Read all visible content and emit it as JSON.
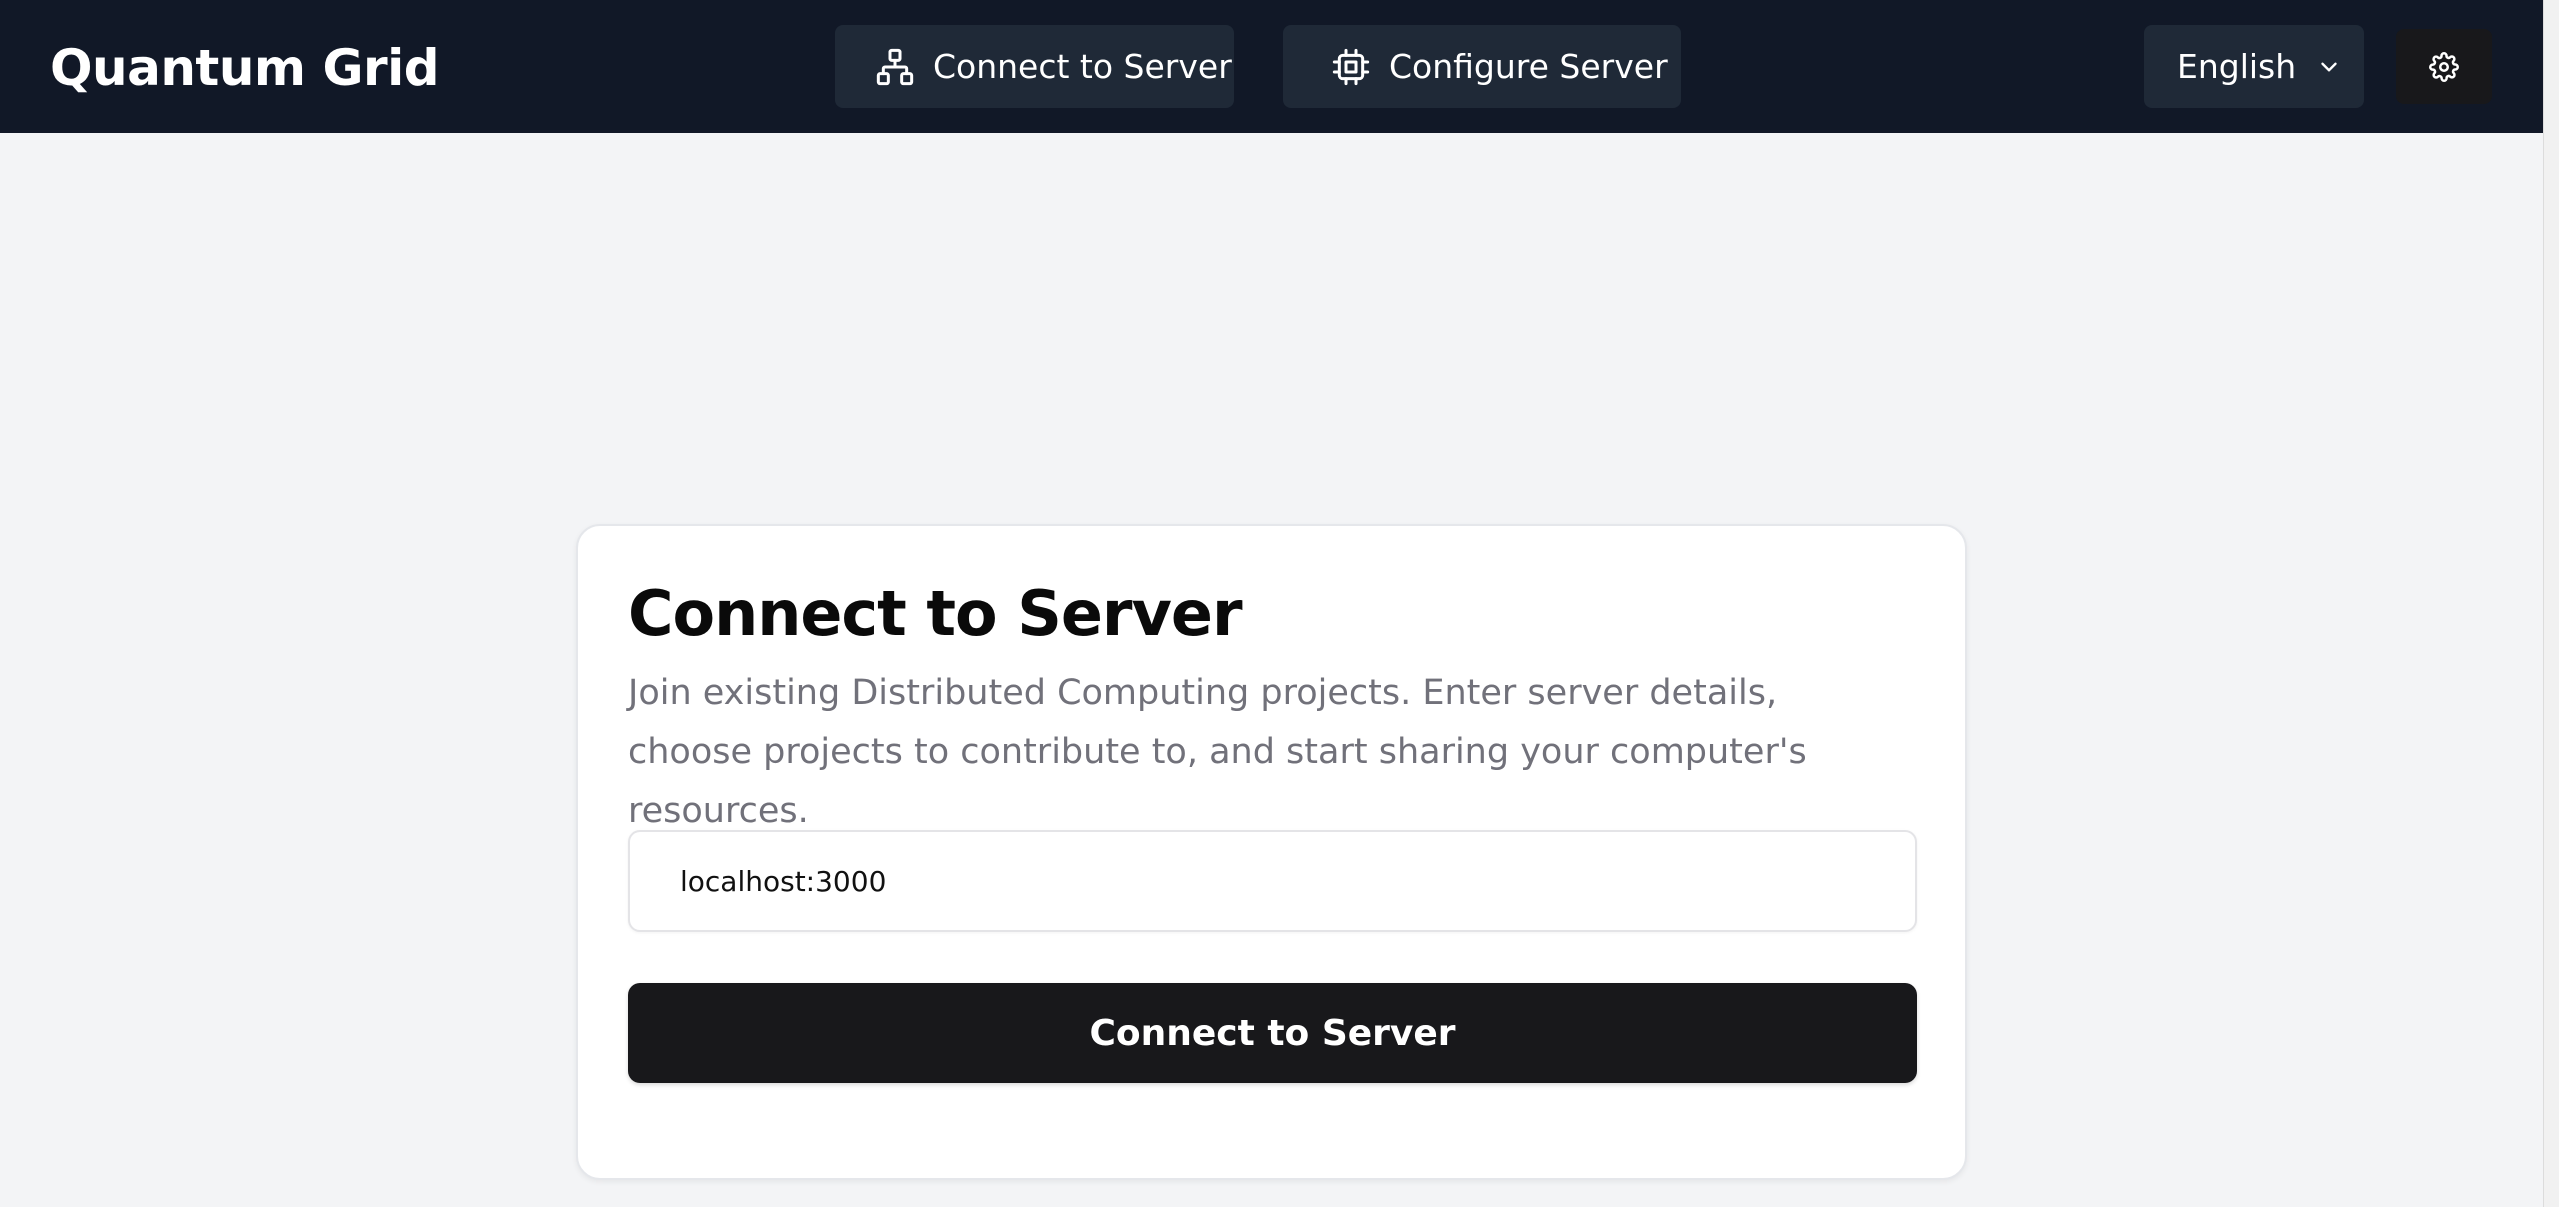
{
  "header": {
    "brand": "Quantum Grid",
    "nav": {
      "connect_label": "Connect to Server",
      "connect_icon": "network-icon",
      "configure_label": "Configure Server",
      "configure_icon": "cpu-icon"
    },
    "language": {
      "selected": "English",
      "icon": "chevron-down-icon"
    },
    "settings_icon": "gear-icon"
  },
  "card": {
    "title": "Connect to Server",
    "description": "Join existing Distributed Computing projects. Enter server details, choose projects to contribute to, and start sharing your computer's resources.",
    "server_input": {
      "value": "localhost:3000"
    },
    "submit_label": "Connect to Server"
  },
  "colors": {
    "navbar_bg": "#111827",
    "nav_button_bg": "#1f2937",
    "page_bg": "#f3f4f6",
    "primary_button_bg": "#18181b",
    "muted_text": "#71717a"
  }
}
